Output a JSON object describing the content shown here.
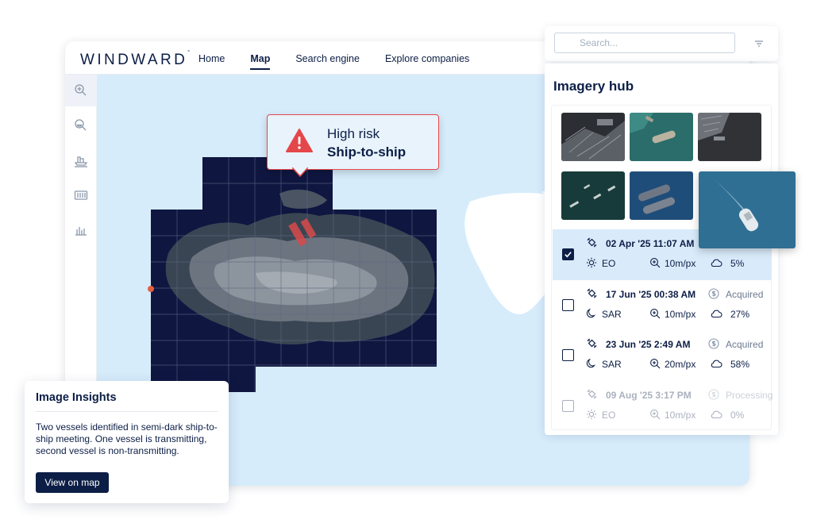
{
  "app": {
    "brand": "WINDWARD",
    "brand_mark": "°"
  },
  "nav": [
    {
      "label": "Home",
      "active": false
    },
    {
      "label": "Map",
      "active": true
    },
    {
      "label": "Search engine",
      "active": false
    },
    {
      "label": "Explore companies",
      "active": false
    }
  ],
  "sidebar": [
    "search-map-icon",
    "search-vessel-icon",
    "port-icon",
    "container-icon",
    "bar-chart-icon"
  ],
  "search": {
    "placeholder": "Search..."
  },
  "hub": {
    "title": "Imagery hub",
    "rows": [
      {
        "date": "02 Apr '25  11:07 AM",
        "status": "",
        "mode": "EO",
        "resolution": "10m/px",
        "cloud": "5%",
        "checked": true,
        "state": "selected"
      },
      {
        "date": "17 Jun '25  00:38 AM",
        "status": "Acquired",
        "mode": "SAR",
        "resolution": "10m/px",
        "cloud": "27%",
        "checked": false,
        "state": "normal"
      },
      {
        "date": "23 Jun '25  2:49 AM",
        "status": "Acquired",
        "mode": "SAR",
        "resolution": "20m/px",
        "cloud": "58%",
        "checked": false,
        "state": "normal"
      },
      {
        "date": "09 Aug '25  3:17 PM",
        "status": "Processing",
        "mode": "EO",
        "resolution": "10m/px",
        "cloud": "0%",
        "checked": false,
        "state": "disabled"
      }
    ]
  },
  "alert": {
    "line1": "High risk",
    "line2": "Ship-to-ship"
  },
  "insights": {
    "title": "Image Insights",
    "body": "Two vessels identified in semi-dark ship-to-ship meeting. One vessel is transmitting, second vessel is non-transmitting.",
    "button": "View on map"
  },
  "colors": {
    "navy": "#0c1e46",
    "sea": "#d6ecfb",
    "alert": "#e4474a",
    "selected_row": "#d9ebfa"
  }
}
